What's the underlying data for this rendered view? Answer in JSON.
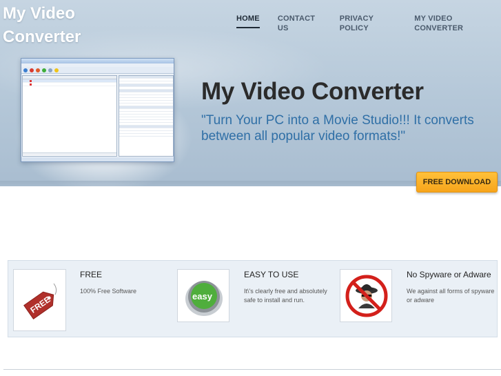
{
  "site": {
    "logo": "My Video Converter"
  },
  "nav": {
    "items": [
      {
        "label": "HOME",
        "active": true
      },
      {
        "label": "CONTACT US",
        "active": false
      },
      {
        "label": "PRIVACY POLICY",
        "active": false
      },
      {
        "label": "MY VIDEO CONVERTER",
        "active": false
      }
    ]
  },
  "hero": {
    "title": "My Video Converter",
    "tagline": "\"Turn Your PC into a Movie Studio!!! It converts between all popular video formats!\"",
    "download_label": "FREE DOWNLOAD"
  },
  "features": [
    {
      "title": "FREE",
      "text": "100% Free Software",
      "icon": "free-tag-icon"
    },
    {
      "title": "EASY TO USE",
      "text": "It\\'s clearly free and absolutely safe to install and run.",
      "icon": "easy-button-icon"
    },
    {
      "title": "No Spyware or Adware",
      "text": "We against all forms of spyware or adware",
      "icon": "no-spyware-icon"
    }
  ],
  "colors": {
    "accent": "#f7a51b",
    "tagline": "#2f6fa6",
    "hero_bg": "#b4c7d8"
  }
}
